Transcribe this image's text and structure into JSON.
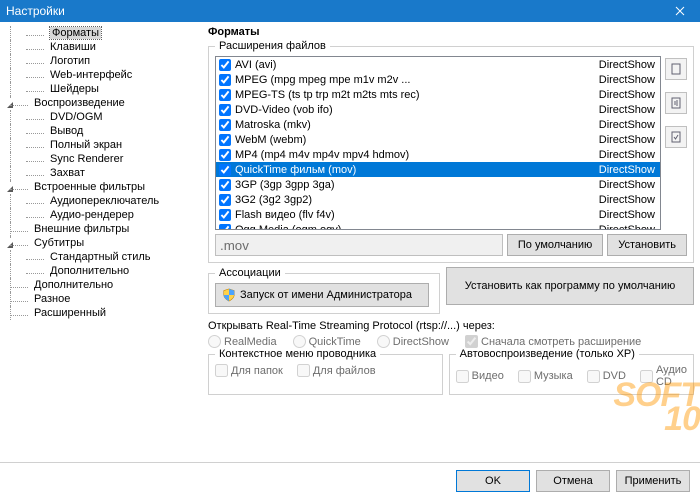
{
  "window": {
    "title": "Настройки"
  },
  "sidebar": {
    "items": [
      {
        "label": "Форматы",
        "level": 2,
        "selected": true
      },
      {
        "label": "Клавиши",
        "level": 2
      },
      {
        "label": "Логотип",
        "level": 2
      },
      {
        "label": "Web-интерфейс",
        "level": 2
      },
      {
        "label": "Шейдеры",
        "level": 2
      },
      {
        "label": "Воспроизведение",
        "level": 1,
        "expanded": true
      },
      {
        "label": "DVD/OGM",
        "level": 2
      },
      {
        "label": "Вывод",
        "level": 2
      },
      {
        "label": "Полный экран",
        "level": 2
      },
      {
        "label": "Sync Renderer",
        "level": 2
      },
      {
        "label": "Захват",
        "level": 2
      },
      {
        "label": "Встроенные фильтры",
        "level": 1,
        "expanded": true
      },
      {
        "label": "Аудиопереключатель",
        "level": 2
      },
      {
        "label": "Аудио-рендерер",
        "level": 2
      },
      {
        "label": "Внешние фильтры",
        "level": 1
      },
      {
        "label": "Субтитры",
        "level": 1,
        "expanded": true
      },
      {
        "label": "Стандартный стиль",
        "level": 2
      },
      {
        "label": "Дополнительно",
        "level": 2
      },
      {
        "label": "Дополнительно",
        "level": 1
      },
      {
        "label": "Разное",
        "level": 1
      },
      {
        "label": "Расширенный",
        "level": 1
      }
    ]
  },
  "main": {
    "title": "Форматы",
    "file_ext_legend": "Расширения файлов",
    "formats": [
      {
        "checked": true,
        "name": "AVI (avi)",
        "engine": "DirectShow"
      },
      {
        "checked": true,
        "name": "MPEG (mpg mpeg mpe m1v m2v ...",
        "engine": "DirectShow"
      },
      {
        "checked": true,
        "name": "MPEG-TS (ts tp trp m2t m2ts mts rec)",
        "engine": "DirectShow"
      },
      {
        "checked": true,
        "name": "DVD-Video (vob ifo)",
        "engine": "DirectShow"
      },
      {
        "checked": true,
        "name": "Matroska (mkv)",
        "engine": "DirectShow"
      },
      {
        "checked": true,
        "name": "WebM (webm)",
        "engine": "DirectShow"
      },
      {
        "checked": true,
        "name": "MP4 (mp4 m4v mp4v mpv4 hdmov)",
        "engine": "DirectShow"
      },
      {
        "checked": true,
        "name": "QuickTime фильм (mov)",
        "engine": "DirectShow",
        "selected": true
      },
      {
        "checked": true,
        "name": "3GP (3gp 3gpp 3ga)",
        "engine": "DirectShow"
      },
      {
        "checked": true,
        "name": "3G2 (3g2 3gp2)",
        "engine": "DirectShow"
      },
      {
        "checked": true,
        "name": "Flash видео (flv f4v)",
        "engine": "DirectShow"
      },
      {
        "checked": true,
        "name": "Ogg Media (ogm ogv)",
        "engine": "DirectShow"
      }
    ],
    "ext_value": ".mov",
    "btn_default": "По умолчанию",
    "btn_set": "Установить",
    "assoc_legend": "Ассоциации",
    "btn_admin": "Запуск от имени Администратора",
    "btn_set_default_prog": "Установить как программу по умолчанию",
    "rtsp_label": "Открывать Real-Time Streaming Protocol (rtsp://...) через:",
    "rtsp_options": [
      "RealMedia",
      "QuickTime",
      "DirectShow"
    ],
    "rtsp_check_ext": "Сначала смотреть расширение",
    "context_legend": "Контекстное меню проводника",
    "context_folders": "Для папок",
    "context_files": "Для файлов",
    "autoplay_legend": "Автовоспроизведение (только XP)",
    "autoplay_video": "Видео",
    "autoplay_music": "Музыка",
    "autoplay_dvd": "DVD",
    "autoplay_cd": "Аудио CD"
  },
  "footer": {
    "ok": "OK",
    "cancel": "Отмена",
    "apply": "Применить"
  },
  "watermark": {
    "line1": "SOFT",
    "line2": "10"
  }
}
